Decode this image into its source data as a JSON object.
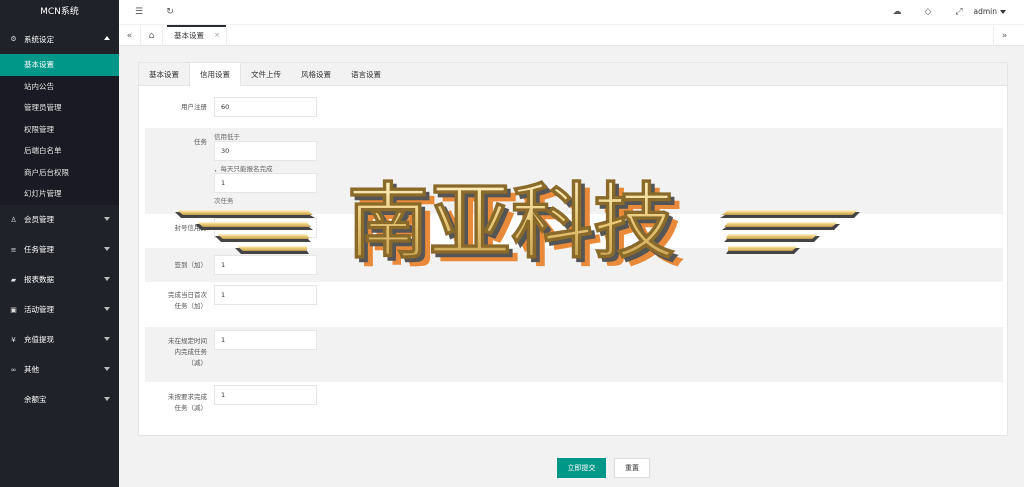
{
  "app": {
    "title": "MCN系统"
  },
  "sidebar": {
    "groups": [
      {
        "label": "系统设定",
        "icon": "gear-icon",
        "glyph": "⚙"
      },
      {
        "label": "会员管理",
        "icon": "user-icon",
        "glyph": "♙"
      },
      {
        "label": "任务管理",
        "icon": "list-icon",
        "glyph": "≡"
      },
      {
        "label": "报表数据",
        "icon": "chart-icon",
        "glyph": "▰"
      },
      {
        "label": "活动管理",
        "icon": "gift-icon",
        "glyph": "▣"
      },
      {
        "label": "充值提现",
        "icon": "yen-icon",
        "glyph": "¥"
      },
      {
        "label": "其他",
        "icon": "link-icon",
        "glyph": "∞"
      },
      {
        "label": "余额宝",
        "icon": "",
        "glyph": ""
      }
    ],
    "sub_items": [
      "基本设置",
      "站内公告",
      "管理员管理",
      "权限管理",
      "后端白名单",
      "商户后台权限",
      "幻灯片管理"
    ]
  },
  "header": {
    "menu_glyph": "☰",
    "refresh_glyph": "↻",
    "theme_glyph": "☁",
    "tag_glyph": "◇",
    "fullscreen_glyph": "⤢",
    "user": "admin"
  },
  "tabsbar": {
    "prev_glyph": "«",
    "home_glyph": "⌂",
    "next_glyph": "»",
    "current_tab": "基本设置",
    "close_glyph": "×"
  },
  "card": {
    "tabs": [
      "基本设置",
      "信用设置",
      "文件上传",
      "风格设置",
      "语言设置"
    ],
    "active_tab_index": 1
  },
  "form": {
    "register": {
      "label": "用户注册",
      "value": "60"
    },
    "task": {
      "label": "任务",
      "hint1": "信用低于",
      "value1": "30",
      "hint2": "，每天只能报名完成",
      "value2": "1",
      "hint3": "次任务"
    },
    "freeze": {
      "label": "封号信用分",
      "value": "0"
    },
    "checkin": {
      "label": "签到（加）",
      "value": "1"
    },
    "first_task": {
      "label_line1": "完成当日首次",
      "label_line2": "任务（加）",
      "value": "1"
    },
    "overdue": {
      "label_line1": "未在规定时间",
      "label_line2": "内完成任务",
      "label_line3": "（减）",
      "value": "1"
    },
    "unqualified": {
      "label_line1": "未按要求完成",
      "label_line2": "任务（减）",
      "value": "1"
    }
  },
  "buttons": {
    "submit": "立即提交",
    "reset": "重置"
  },
  "watermark": {
    "text": "南亚科技"
  }
}
